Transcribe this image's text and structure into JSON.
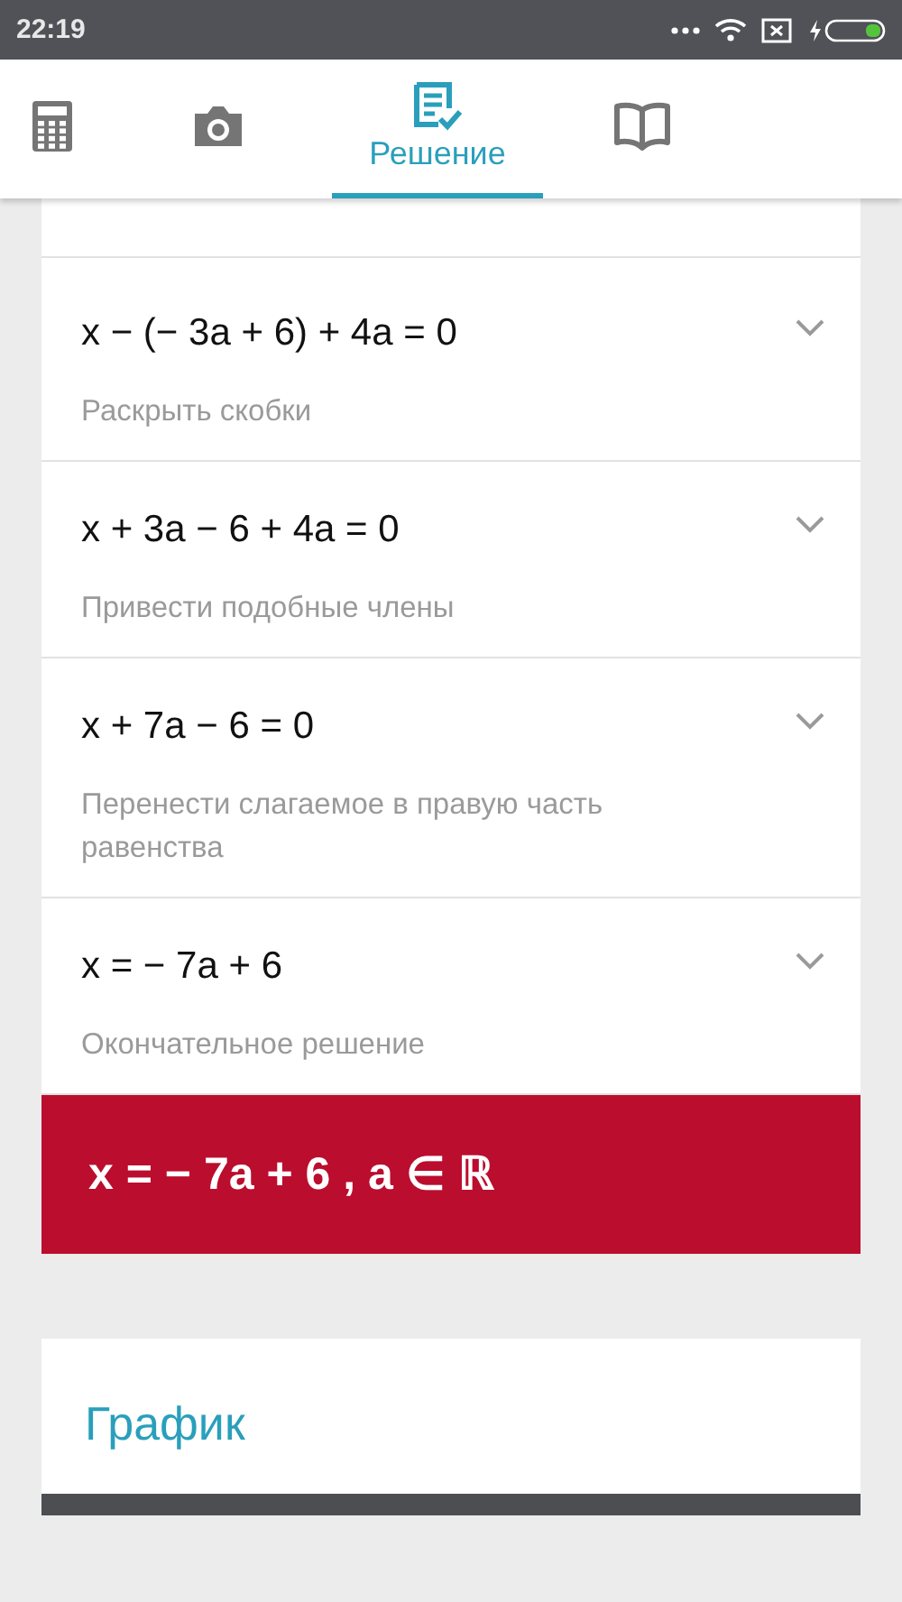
{
  "status_bar": {
    "time": "22:19"
  },
  "tabs": [
    {
      "kind": "calculator",
      "selected": false
    },
    {
      "kind": "camera",
      "selected": false
    },
    {
      "kind": "solution",
      "label": "Решение",
      "selected": true
    },
    {
      "kind": "book",
      "selected": false
    }
  ],
  "steps": [
    {
      "equation": "x − (− 3a + 6) + 4a = 0",
      "description": "Раскрыть скобки",
      "expanded": false
    },
    {
      "equation": "x + 3a − 6 + 4a = 0",
      "description": "Привести подобные члены",
      "expanded": false
    },
    {
      "equation": "x + 7a − 6 = 0",
      "description": "Перенести слагаемое в правую часть равенства",
      "expanded": false
    },
    {
      "equation": "x = − 7a + 6",
      "description": "Окончательное решение",
      "expanded": false
    }
  ],
  "result": "x = − 7a + 6 , a ∈ ℝ",
  "graph": {
    "title": "График"
  }
}
